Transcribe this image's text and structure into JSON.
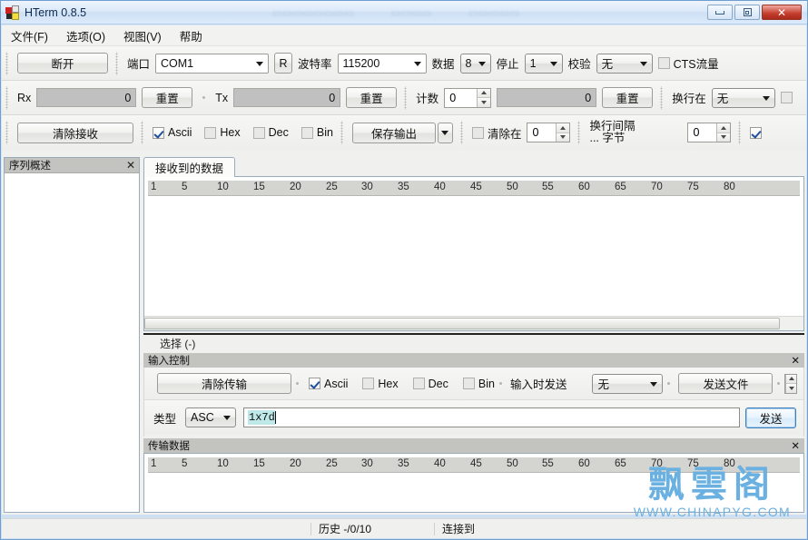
{
  "window": {
    "title": "HTerm 0.8.5",
    "minimize_label": "",
    "maximize_label": "",
    "close_label": "✕"
  },
  "menu": {
    "items": [
      {
        "label": "文件(F)"
      },
      {
        "label": "选项(O)"
      },
      {
        "label": "视图(V)"
      },
      {
        "label": "帮助"
      }
    ]
  },
  "toolbar": {
    "row1": {
      "disconnect_label": "断开",
      "port_label": "端口",
      "port_value": "COM1",
      "rescan_label": "R",
      "baud_label": "波特率",
      "baud_value": "115200",
      "data_label": "数据",
      "data_value": "8",
      "stop_label": "停止",
      "stop_value": "1",
      "parity_label": "校验",
      "parity_value": "无",
      "cts_label": "CTS流量"
    },
    "row2": {
      "rx_label": "Rx",
      "rx_value": "0",
      "rx_reset_label": "重置",
      "tx_label": "Tx",
      "tx_value": "0",
      "tx_reset_label": "重置",
      "count_label": "计数",
      "count_value": "0",
      "count_total": "0",
      "count_reset_label": "重置",
      "newline_at_label": "换行在",
      "newline_at_value": "无"
    },
    "row3": {
      "clear_received_label": "清除接收",
      "ascii_label": "Ascii",
      "hex_label": "Hex",
      "dec_label": "Dec",
      "bin_label": "Bin",
      "save_output_label": "保存输出",
      "clear_at_label": "清除在",
      "clear_at_value": "0",
      "newline_every_label": "换行间隔",
      "newline_every_sub": "... 字节",
      "newline_every_value": "0"
    }
  },
  "sidebar": {
    "title": "序列概述",
    "close_label": "✕"
  },
  "receive": {
    "tab_label": "接收到的数据",
    "ruler": [
      "1",
      "5",
      "10",
      "15",
      "20",
      "25",
      "30",
      "35",
      "40",
      "45",
      "50",
      "55",
      "60",
      "65",
      "70",
      "75",
      "80"
    ],
    "selection_label": "选择  (-)"
  },
  "input_control": {
    "title": "输入控制",
    "close_label": "✕",
    "clear_transmit_label": "清除传输",
    "ascii_label": "Ascii",
    "hex_label": "Hex",
    "dec_label": "Dec",
    "bin_label": "Bin",
    "send_on_enter_label": "输入时发送",
    "send_on_enter_value": "无",
    "send_file_label": "发送文件",
    "type_label": "类型",
    "type_value": "ASC",
    "input_value": "1x7d",
    "send_label": "发送"
  },
  "transmit": {
    "title": "传输数据",
    "close_label": "✕",
    "ruler": [
      "1",
      "5",
      "10",
      "15",
      "20",
      "25",
      "30",
      "35",
      "40",
      "45",
      "50",
      "55",
      "60",
      "65",
      "70",
      "75",
      "80"
    ]
  },
  "statusbar": {
    "history_label": "历史 -/0/10",
    "connected_label": "连接到"
  },
  "watermark": {
    "cn": "飘雲阁",
    "url": "WWW.CHINAPYG.COM"
  },
  "colors": {
    "accent": "#6ab0e0",
    "titlebar": "#dbe9f9",
    "panel": "#f0f0ee",
    "selection": "#bfe8e8"
  }
}
